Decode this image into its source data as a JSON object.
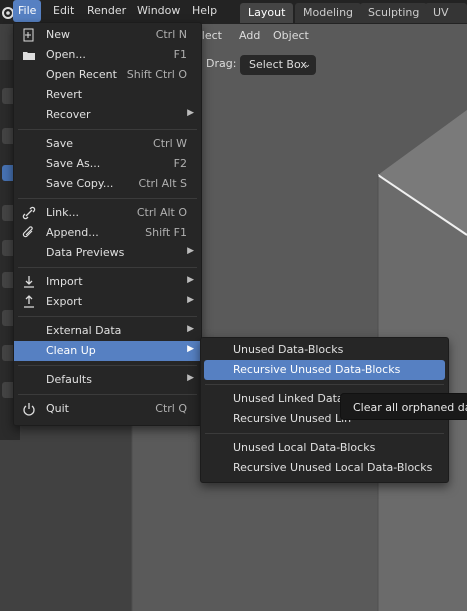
{
  "menubar": {
    "items": [
      "File",
      "Edit",
      "Render",
      "Window",
      "Help"
    ],
    "workspace_tabs": [
      "Layout",
      "Modeling",
      "Sculpting",
      "UV Edi"
    ]
  },
  "viewport": {
    "header_items": [
      "elect",
      "Add",
      "Object"
    ],
    "drag_label": "Drag:",
    "drag_value": "Select Box"
  },
  "file_menu": {
    "new": {
      "label": "New",
      "shortcut": "Ctrl N"
    },
    "open": {
      "label": "Open...",
      "shortcut": "F1"
    },
    "open_recent": {
      "label": "Open Recent",
      "shortcut": "Shift Ctrl O"
    },
    "revert": {
      "label": "Revert"
    },
    "recover": {
      "label": "Recover"
    },
    "save": {
      "label": "Save",
      "shortcut": "Ctrl W"
    },
    "save_as": {
      "label": "Save As...",
      "shortcut": "F2"
    },
    "save_copy": {
      "label": "Save Copy...",
      "shortcut": "Ctrl Alt S"
    },
    "link": {
      "label": "Link...",
      "shortcut": "Ctrl Alt O"
    },
    "append": {
      "label": "Append...",
      "shortcut": "Shift F1"
    },
    "data_previews": {
      "label": "Data Previews"
    },
    "import": {
      "label": "Import"
    },
    "export": {
      "label": "Export"
    },
    "external_data": {
      "label": "External Data"
    },
    "clean_up": {
      "label": "Clean Up"
    },
    "defaults": {
      "label": "Defaults"
    },
    "quit": {
      "label": "Quit",
      "shortcut": "Ctrl Q"
    }
  },
  "cleanup_submenu": {
    "items": [
      "Unused Data-Blocks",
      "Recursive Unused Data-Blocks",
      "Unused Linked Data-B",
      "Recursive Unused Lin",
      "Unused Local Data-Blocks",
      "Recursive Unused Local Data-Blocks"
    ]
  },
  "tooltip": {
    "text": "Clear all orphaned data"
  },
  "colors": {
    "accent": "#5680c2",
    "menu_bg": "#262626",
    "viewport_bg": "#3f3f3f"
  }
}
